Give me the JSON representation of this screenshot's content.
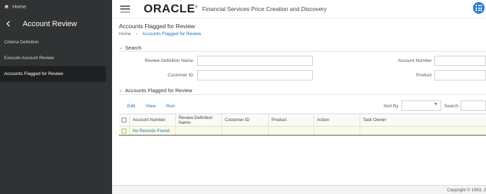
{
  "sidebar": {
    "home_label": "Home",
    "header_title": "Account Review",
    "items": [
      {
        "label": "Criteria Definition"
      },
      {
        "label": "Execute Account Review"
      },
      {
        "label": "Accounts Flagged for Review"
      }
    ]
  },
  "topbar": {
    "logo": "ORACLE",
    "logo_reg": "®",
    "app_title": "Financial Services Price Creation and Discovery"
  },
  "page": {
    "title": "Accounts Flagged for Review",
    "breadcrumb": [
      "Home",
      "Accounts Flagged for Review"
    ]
  },
  "search_section": {
    "heading": "Search",
    "fields": {
      "review_definition_name": {
        "label": "Review Definition Name",
        "value": ""
      },
      "account_number": {
        "label": "Account Number",
        "value": ""
      },
      "customer_id": {
        "label": "Customer ID",
        "value": ""
      },
      "product": {
        "label": "Product",
        "value": ""
      }
    }
  },
  "results_section": {
    "heading": "Accounts Flagged for Review",
    "actions": [
      "Edit",
      "View",
      "Run"
    ],
    "sort_by_label": "Sort By",
    "sort_by_value": "",
    "search_label": "Search",
    "columns": [
      "Account Number",
      "Review Definition Name",
      "Customer ID",
      "Product",
      "Action",
      "Task Owner"
    ],
    "empty_message": "No Records Found"
  },
  "footer": {
    "copyright": "Copyright © 1993, 2"
  },
  "colors": {
    "sidebar_bg": "#303233",
    "link": "#1e6fb8",
    "empty_row_bg": "#fbfae5",
    "apps_button": "#2f7fd1"
  }
}
